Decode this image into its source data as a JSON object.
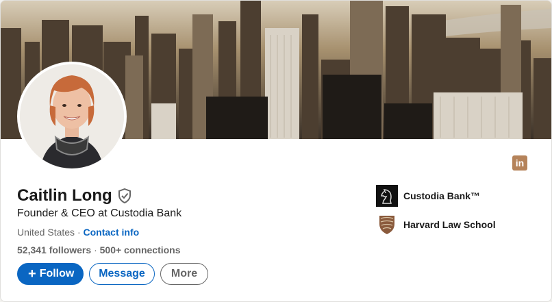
{
  "profile": {
    "name": "Caitlin Long",
    "headline": "Founder & CEO at Custodia Bank",
    "location": "United States",
    "separator": "·",
    "contact_info": "Contact info",
    "followers": "52,341 followers",
    "connections_sep": "·",
    "connections": "500+ connections"
  },
  "buttons": {
    "follow_plus": "+",
    "follow": "Follow",
    "message": "Message",
    "more": "More"
  },
  "experience": [
    {
      "label": "Custodia Bank™",
      "logo": "custodia-knight-icon"
    },
    {
      "label": "Harvard Law School",
      "logo": "harvard-shield-icon"
    }
  ],
  "icons": {
    "linkedin": "in",
    "verified": "shield-check-icon"
  },
  "colors": {
    "primary": "#0a66c2",
    "text": "#191919",
    "muted": "#666666",
    "linkedin_icon": "#b5835a"
  }
}
